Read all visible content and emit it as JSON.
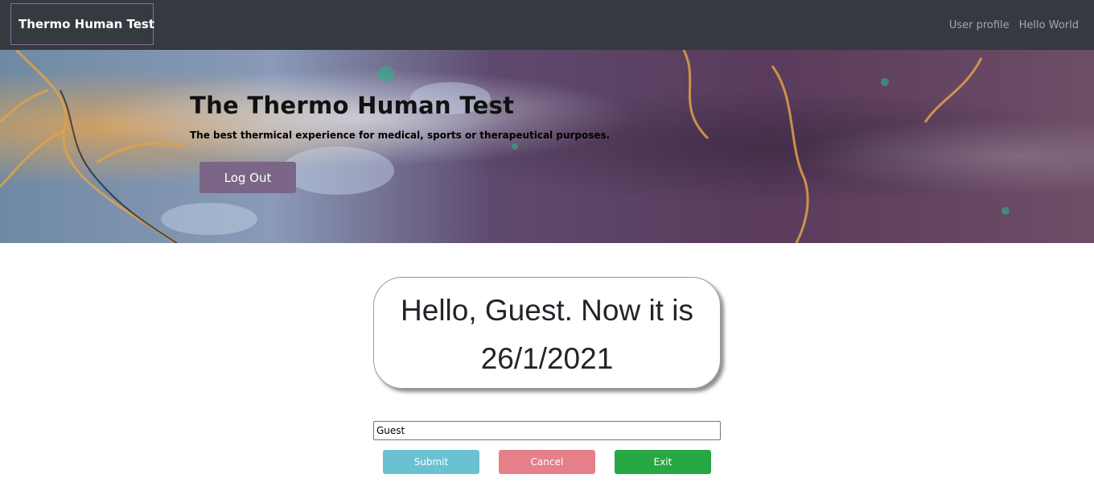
{
  "navbar": {
    "brand": "Thermo Human Test",
    "links": [
      "User profile",
      "Hello World"
    ]
  },
  "hero": {
    "title": "The Thermo Human Test",
    "subtitle": "The best thermical experience for medical, sports or therapeutical purposes.",
    "logout_label": "Log Out"
  },
  "greeting": {
    "line1": "Hello, Guest. Now it is",
    "line2": "26/1/2021"
  },
  "form": {
    "name_value": "Guest",
    "submit_label": "Submit",
    "cancel_label": "Cancel",
    "exit_label": "Exit"
  },
  "colors": {
    "navbar": "#343a40",
    "logout": "#7b6687",
    "submit": "#6ac1d2",
    "cancel": "#e57f8a",
    "exit": "#28a745"
  }
}
